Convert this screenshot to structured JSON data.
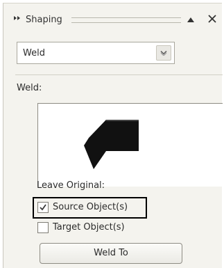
{
  "panel": {
    "title": "Shaping",
    "icons": {
      "expand": "double-right-arrow-icon",
      "collapse": "triangle-up-icon",
      "close": "close-icon"
    }
  },
  "mode_dropdown": {
    "selected": "Weld",
    "options_visible": [
      "Weld"
    ],
    "icon": "chevron-down-icon"
  },
  "section": {
    "label": "Weld:"
  },
  "preview": {
    "icon": "weld-arrow-preview-icon"
  },
  "leave_original": {
    "label": "Leave Original:",
    "source": {
      "label": "Source Object(s)",
      "checked": true
    },
    "target": {
      "label": "Target Object(s)",
      "checked": false
    }
  },
  "actions": {
    "apply_label": "Weld To"
  },
  "colors": {
    "panel_bg": "#f4f3ee",
    "highlight_border": "#000000",
    "preview_shape": "#111111"
  }
}
